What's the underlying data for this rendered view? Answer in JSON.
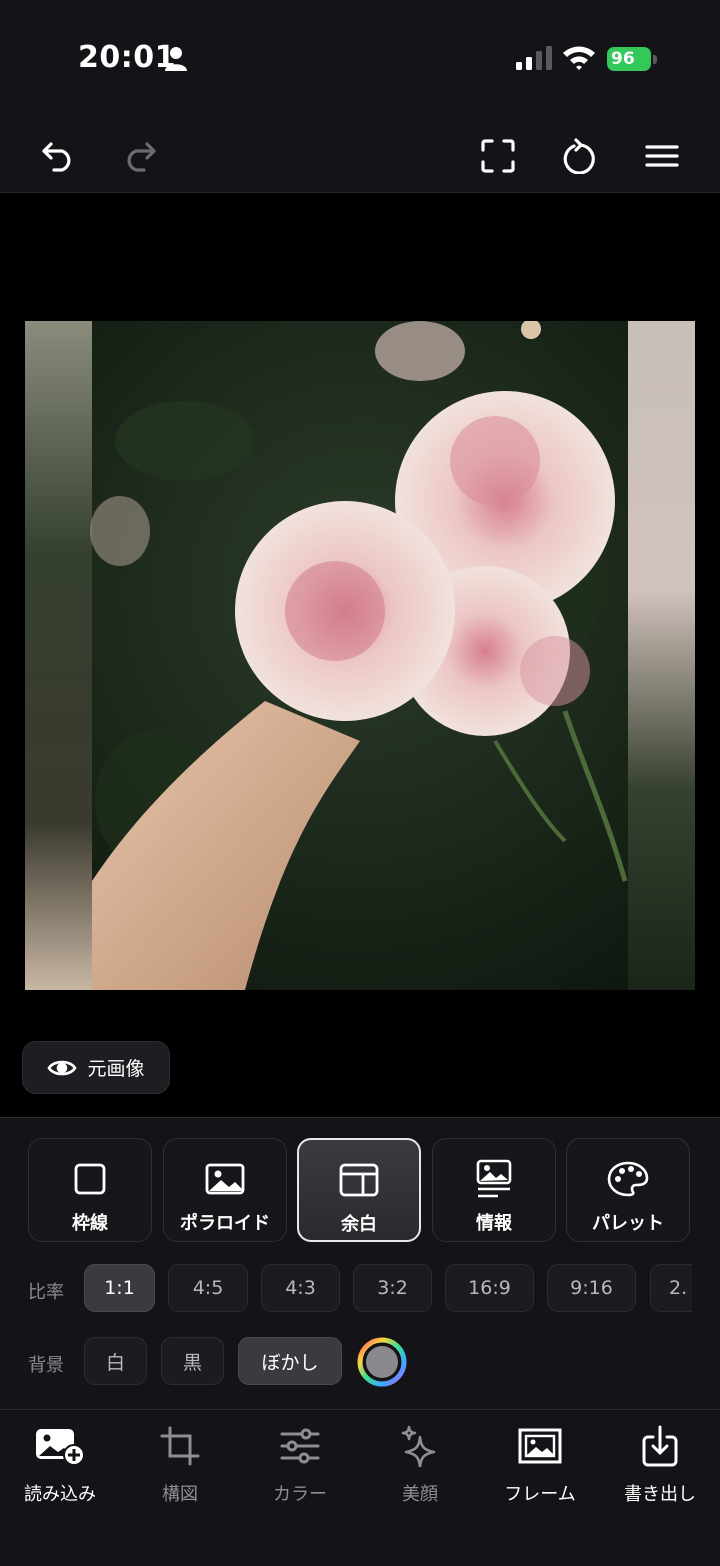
{
  "status_bar": {
    "time": "20:01",
    "battery": "96"
  },
  "toolbar": {
    "undo_icon": "undo-icon",
    "redo_icon": "redo-icon",
    "fullscreen_icon": "fullscreen-icon",
    "reset_icon": "rotate-reset-icon",
    "menu_icon": "hamburger-menu-icon"
  },
  "original_button": {
    "label": "元画像",
    "icon": "eye-icon"
  },
  "frames": [
    {
      "label": "枠線",
      "icon": "square-icon",
      "selected": false
    },
    {
      "label": "ポラロイド",
      "icon": "image-icon",
      "selected": false
    },
    {
      "label": "余白",
      "icon": "margin-layout-icon",
      "selected": true
    },
    {
      "label": "情報",
      "icon": "image-info-icon",
      "selected": false
    },
    {
      "label": "パレット",
      "icon": "palette-icon",
      "selected": false
    }
  ],
  "ratio": {
    "label": "比率",
    "options": [
      "1:1",
      "4:5",
      "4:3",
      "3:2",
      "16:9",
      "9:16",
      "2."
    ],
    "selected": "1:1"
  },
  "background": {
    "label": "背景",
    "options": [
      "白",
      "黒",
      "ぼかし"
    ],
    "selected": "ぼかし",
    "color_picker_icon": "color-wheel-icon"
  },
  "bottom_nav": [
    {
      "label": "読み込み",
      "icon": "image-add-icon"
    },
    {
      "label": "構図",
      "icon": "crop-icon"
    },
    {
      "label": "カラー",
      "icon": "sliders-icon"
    },
    {
      "label": "美顔",
      "icon": "sparkles-icon"
    },
    {
      "label": "フレーム",
      "icon": "frame-icon"
    },
    {
      "label": "書き出し",
      "icon": "export-download-icon"
    }
  ],
  "colors": {
    "background": "#131318",
    "canvas": "#000000",
    "battery": "#34c759"
  }
}
